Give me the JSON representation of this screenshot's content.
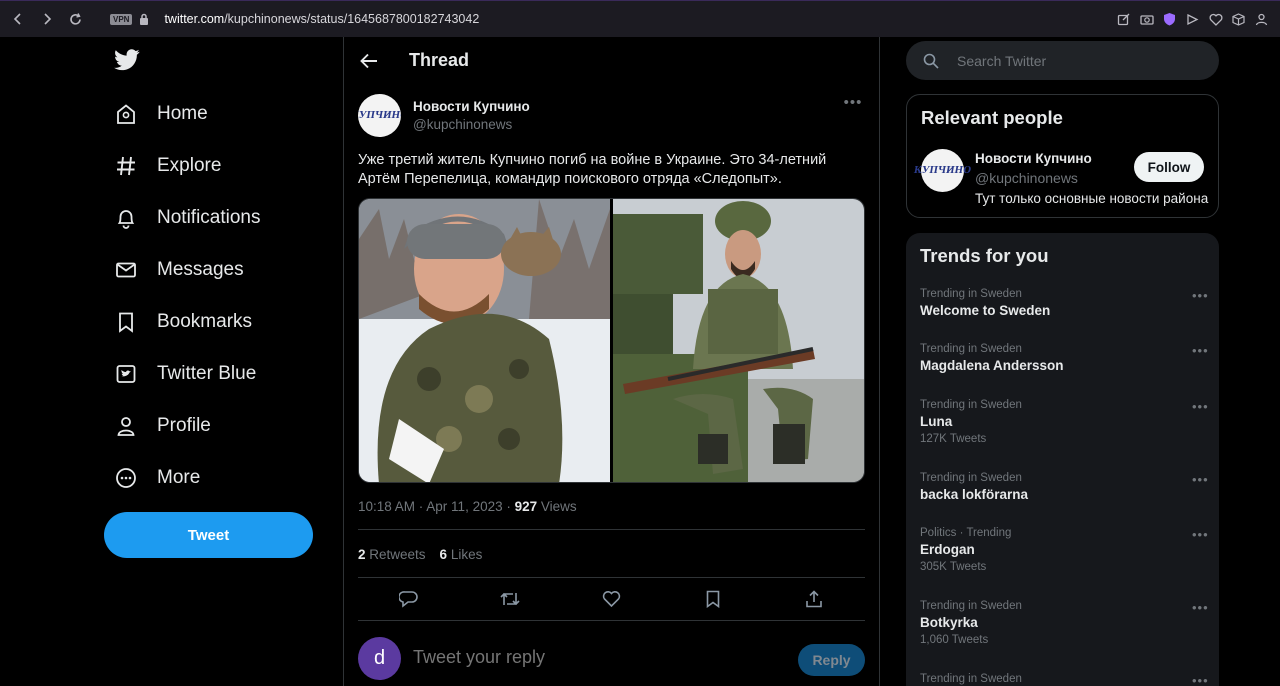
{
  "browser": {
    "vpn_label": "VPN",
    "url_host": "twitter.com",
    "url_path": "/kupchinonews/status/1645687800182743042"
  },
  "sidebar": {
    "items": [
      {
        "label": "Home",
        "icon": "home-icon"
      },
      {
        "label": "Explore",
        "icon": "hashtag-icon"
      },
      {
        "label": "Notifications",
        "icon": "bell-icon"
      },
      {
        "label": "Messages",
        "icon": "envelope-icon"
      },
      {
        "label": "Bookmarks",
        "icon": "bookmark-icon"
      },
      {
        "label": "Twitter Blue",
        "icon": "twitter-blue-icon"
      },
      {
        "label": "Profile",
        "icon": "person-icon"
      },
      {
        "label": "More",
        "icon": "more-circle-icon"
      }
    ],
    "tweet_button": "Tweet"
  },
  "thread": {
    "title": "Thread",
    "author_name": "Новости Купчино",
    "author_handle": "@kupchinonews",
    "avatar_text": "КУПЧИНО",
    "text_line1": "Уже третий житель Купчино погиб на войне в Украине. Это 34-летний",
    "text_line2": "Артём Перепелица, командир поискового отряда «Следопыт».",
    "time": "10:18 AM · Apr 11, 2023 · ",
    "views_count": "927",
    "views_label": " Views",
    "retweets_count": "2",
    "retweets_label": " Retweets",
    "likes_count": "6",
    "likes_label": " Likes",
    "reply_placeholder": "Tweet your reply",
    "reply_avatar_letter": "d",
    "reply_button": "Reply"
  },
  "right": {
    "search_placeholder": "Search Twitter",
    "relevant_title": "Relevant people",
    "person": {
      "name": "Новости Купчино",
      "handle": "@kupchinonews",
      "bio": "Тут только основные новости района",
      "follow": "Follow"
    },
    "trends_title": "Trends for you",
    "trends": [
      {
        "context": "Trending in Sweden",
        "name": "Welcome to Sweden",
        "count": ""
      },
      {
        "context": "Trending in Sweden",
        "name": "Magdalena Andersson",
        "count": ""
      },
      {
        "context": "Trending in Sweden",
        "name": "Luna",
        "count": "127K Tweets"
      },
      {
        "context": "Trending in Sweden",
        "name": "backa lokförarna",
        "count": ""
      },
      {
        "context": "Politics · Trending",
        "name": "Erdogan",
        "count": "305K Tweets"
      },
      {
        "context": "Trending in Sweden",
        "name": "Botkyrka",
        "count": "1,060 Tweets"
      },
      {
        "context": "Trending in Sweden",
        "name": "",
        "count": ""
      }
    ]
  },
  "colors": {
    "accent": "#1d9bf0",
    "background": "#000000",
    "muted_text": "#71767b"
  }
}
